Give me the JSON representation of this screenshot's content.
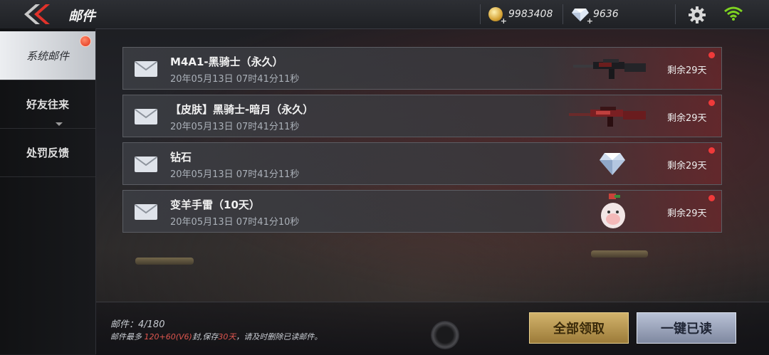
{
  "header": {
    "title": "邮件",
    "gold": "9983408",
    "diamonds": "9636"
  },
  "sidebar": {
    "items": [
      {
        "label": "系统邮件",
        "active": true,
        "badge": true
      },
      {
        "label": "好友往来",
        "active": false
      },
      {
        "label": "处罚反馈",
        "active": false
      }
    ]
  },
  "mails": [
    {
      "title": "M4A1-黑骑士（永久）",
      "time": "20年05月13日 07时41分11秒",
      "remaining": "剩余29天",
      "item_icon": "rifle-dark-icon"
    },
    {
      "title": "【皮肤】黑骑士-暗月（永久）",
      "time": "20年05月13日 07时41分11秒",
      "remaining": "剩余29天",
      "item_icon": "rifle-red-icon"
    },
    {
      "title": "钻石",
      "time": "20年05月13日 07时41分11秒",
      "remaining": "剩余29天",
      "item_icon": "diamond-icon"
    },
    {
      "title": "变羊手雷（10天）",
      "time": "20年05月13日 07时41分10秒",
      "remaining": "剩余29天",
      "item_icon": "sheep-grenade-icon"
    }
  ],
  "footer": {
    "count": "邮件：4/180",
    "notice_prefix": "邮件最多 ",
    "notice_limit": "120+60(V6)",
    "notice_mid": "封,保存",
    "notice_days": "30天",
    "notice_suffix": "，请及时删除已读邮件。",
    "claim_all": "全部领取",
    "mark_all_read": "一键已读"
  },
  "colors": {
    "accent_red": "#e0321a",
    "gold_button": "#d2b36c",
    "silver_button": "#b9c2d6",
    "wifi_green": "#7ed321"
  }
}
